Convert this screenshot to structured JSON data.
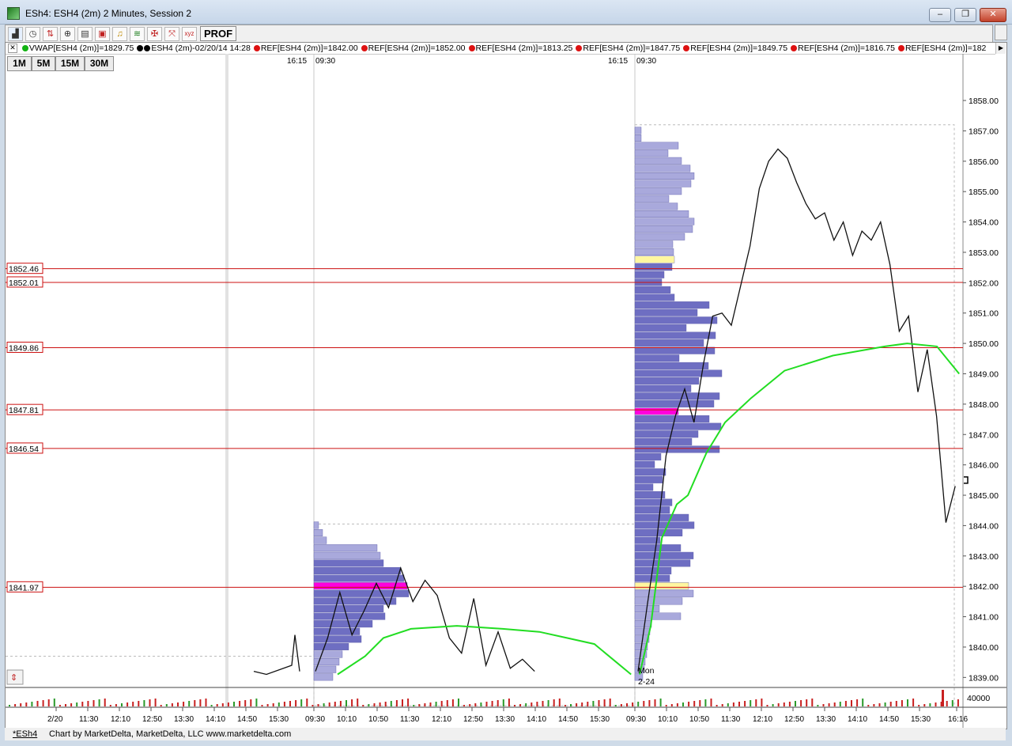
{
  "window": {
    "title": "ESh4: ESH4 (2m) 2 Minutes, Session 2",
    "minimize_symbol": "–",
    "maximize_symbol": "❐",
    "close_symbol": "✕"
  },
  "toolbar": {
    "icons": [
      "chart-type-icon",
      "clock-icon",
      "indicator-icon",
      "zoom-icon",
      "draw-tools-icon",
      "chart-icon",
      "alert-bell-icon",
      "market-profile-icon",
      "crosshair-icon",
      "scale-icon",
      "xyz-icon"
    ],
    "prof_label": "PROF"
  },
  "info_bar": {
    "close_symbol": "✕",
    "items": [
      {
        "text": "VWAP[ESH4 (2m)]=1829.75",
        "color": "#12b312"
      },
      {
        "text": "ESH4 (2m)-02/20/14 14:28",
        "color": "#000000"
      },
      {
        "text": "REF[ESH4 (2m)]=1842.00",
        "color": "#dd1111"
      },
      {
        "text": "REF[ESH4 (2m)]=1852.00",
        "color": "#dd1111"
      },
      {
        "text": "REF[ESH4 (2m)]=1813.25",
        "color": "#dd1111"
      },
      {
        "text": "REF[ESH4 (2m)]=1847.75",
        "color": "#dd1111"
      },
      {
        "text": "REF[ESH4 (2m)]=1849.75",
        "color": "#dd1111"
      },
      {
        "text": "REF[ESH4 (2m)]=1816.75",
        "color": "#dd1111"
      },
      {
        "text": "REF[ESH4 (2m)]=182",
        "color": "#dd1111"
      }
    ]
  },
  "timeframes": [
    "1M",
    "5M",
    "15M",
    "30M"
  ],
  "session_markers": [
    {
      "close": "16:15",
      "open": "09:30"
    },
    {
      "close": "16:15",
      "open": "09:30"
    }
  ],
  "chart_data": {
    "type": "line",
    "instrument": "ESH4 (2m)",
    "y_axis": {
      "range": [
        1838.8,
        1858.6
      ],
      "ticks": [
        "1858.00",
        "1857.00",
        "1856.00",
        "1855.00",
        "1854.00",
        "1853.00",
        "1852.00",
        "1851.00",
        "1850.00",
        "1849.00",
        "1848.00",
        "1847.00",
        "1846.00",
        "1845.00",
        "1844.00",
        "1843.00",
        "1842.00",
        "1841.00",
        "1840.00",
        "1839.00"
      ]
    },
    "x_axis_labels": [
      "2/20",
      "11:30",
      "12:10",
      "12:50",
      "13:30",
      "14:10",
      "14:50",
      "15:30",
      "09:30",
      "10:10",
      "10:50",
      "11:30",
      "12:10",
      "12:50",
      "13:30",
      "14:10",
      "14:50",
      "15:30",
      "09:30",
      "10:10",
      "10:50",
      "11:30",
      "12:10",
      "12:50",
      "13:30",
      "14:10",
      "14:50",
      "15:30",
      "16:16"
    ],
    "reference_lines": [
      "1852.46",
      "1852.01",
      "1849.86",
      "1847.81",
      "1846.54",
      "1841.97"
    ],
    "vwap_day1": [
      [
        0,
        1839.1
      ],
      [
        6,
        1839.7
      ],
      [
        10,
        1840.3
      ],
      [
        16,
        1840.6
      ],
      [
        26,
        1840.7
      ],
      [
        36,
        1840.6
      ],
      [
        44,
        1840.5
      ],
      [
        50,
        1840.3
      ],
      [
        56,
        1840.1
      ],
      [
        60,
        1839.6
      ],
      [
        64,
        1839.1
      ]
    ],
    "vwap_day2": [
      [
        0,
        1839.1
      ],
      [
        3,
        1840.7
      ],
      [
        6,
        1843.6
      ],
      [
        10,
        1844.7
      ],
      [
        13,
        1845.0
      ],
      [
        18,
        1846.4
      ],
      [
        23,
        1847.4
      ],
      [
        30,
        1848.2
      ],
      [
        39,
        1849.1
      ],
      [
        52,
        1849.6
      ],
      [
        66,
        1849.9
      ],
      [
        72,
        1850.0
      ],
      [
        80,
        1849.9
      ],
      [
        86,
        1849.0
      ]
    ],
    "price_day1": [
      [
        0,
        1839.2
      ],
      [
        2,
        1840.3
      ],
      [
        4,
        1841.8
      ],
      [
        6,
        1840.4
      ],
      [
        8,
        1841.2
      ],
      [
        10,
        1842.1
      ],
      [
        12,
        1841.3
      ],
      [
        14,
        1842.6
      ],
      [
        16,
        1841.5
      ],
      [
        18,
        1842.2
      ],
      [
        20,
        1841.7
      ],
      [
        22,
        1840.3
      ],
      [
        24,
        1839.8
      ],
      [
        26,
        1841.6
      ],
      [
        28,
        1839.4
      ],
      [
        30,
        1840.5
      ],
      [
        32,
        1839.3
      ],
      [
        34,
        1839.6
      ],
      [
        36,
        1839.2
      ]
    ],
    "price_day2": [
      [
        0,
        1839.2
      ],
      [
        2,
        1841.4
      ],
      [
        4,
        1843.5
      ],
      [
        6,
        1846.3
      ],
      [
        8,
        1847.6
      ],
      [
        10,
        1848.5
      ],
      [
        12,
        1847.4
      ],
      [
        14,
        1849.3
      ],
      [
        16,
        1850.9
      ],
      [
        18,
        1851.0
      ],
      [
        20,
        1850.6
      ],
      [
        22,
        1851.9
      ],
      [
        24,
        1853.2
      ],
      [
        26,
        1855.1
      ],
      [
        28,
        1856.0
      ],
      [
        30,
        1856.4
      ],
      [
        32,
        1856.1
      ],
      [
        34,
        1855.3
      ],
      [
        36,
        1854.6
      ],
      [
        38,
        1854.1
      ],
      [
        40,
        1854.3
      ],
      [
        42,
        1853.4
      ],
      [
        44,
        1854.0
      ],
      [
        46,
        1852.9
      ],
      [
        48,
        1853.7
      ],
      [
        50,
        1853.4
      ],
      [
        52,
        1854.0
      ],
      [
        54,
        1852.6
      ],
      [
        56,
        1850.4
      ],
      [
        58,
        1850.9
      ],
      [
        60,
        1848.4
      ],
      [
        62,
        1849.8
      ],
      [
        64,
        1847.6
      ],
      [
        66,
        1844.1
      ],
      [
        68,
        1845.3
      ]
    ],
    "volume_axis_label": "40000"
  },
  "profiles": {
    "day1_poc": 1842.0,
    "day2_poc": 1847.8
  },
  "day_label": {
    "line1": "Mon",
    "line2": "2-24"
  },
  "status_bar": {
    "tab": "*ESh4",
    "credit": "Chart by MarketDelta, MarketDelta, LLC www.marketdelta.com"
  },
  "colors": {
    "ref_line": "#cc1111",
    "vwap": "#22dd22",
    "profile_bar": "#6e6ec2",
    "poc": "#ff00dd",
    "value_area_edge": "#fff7a0"
  }
}
